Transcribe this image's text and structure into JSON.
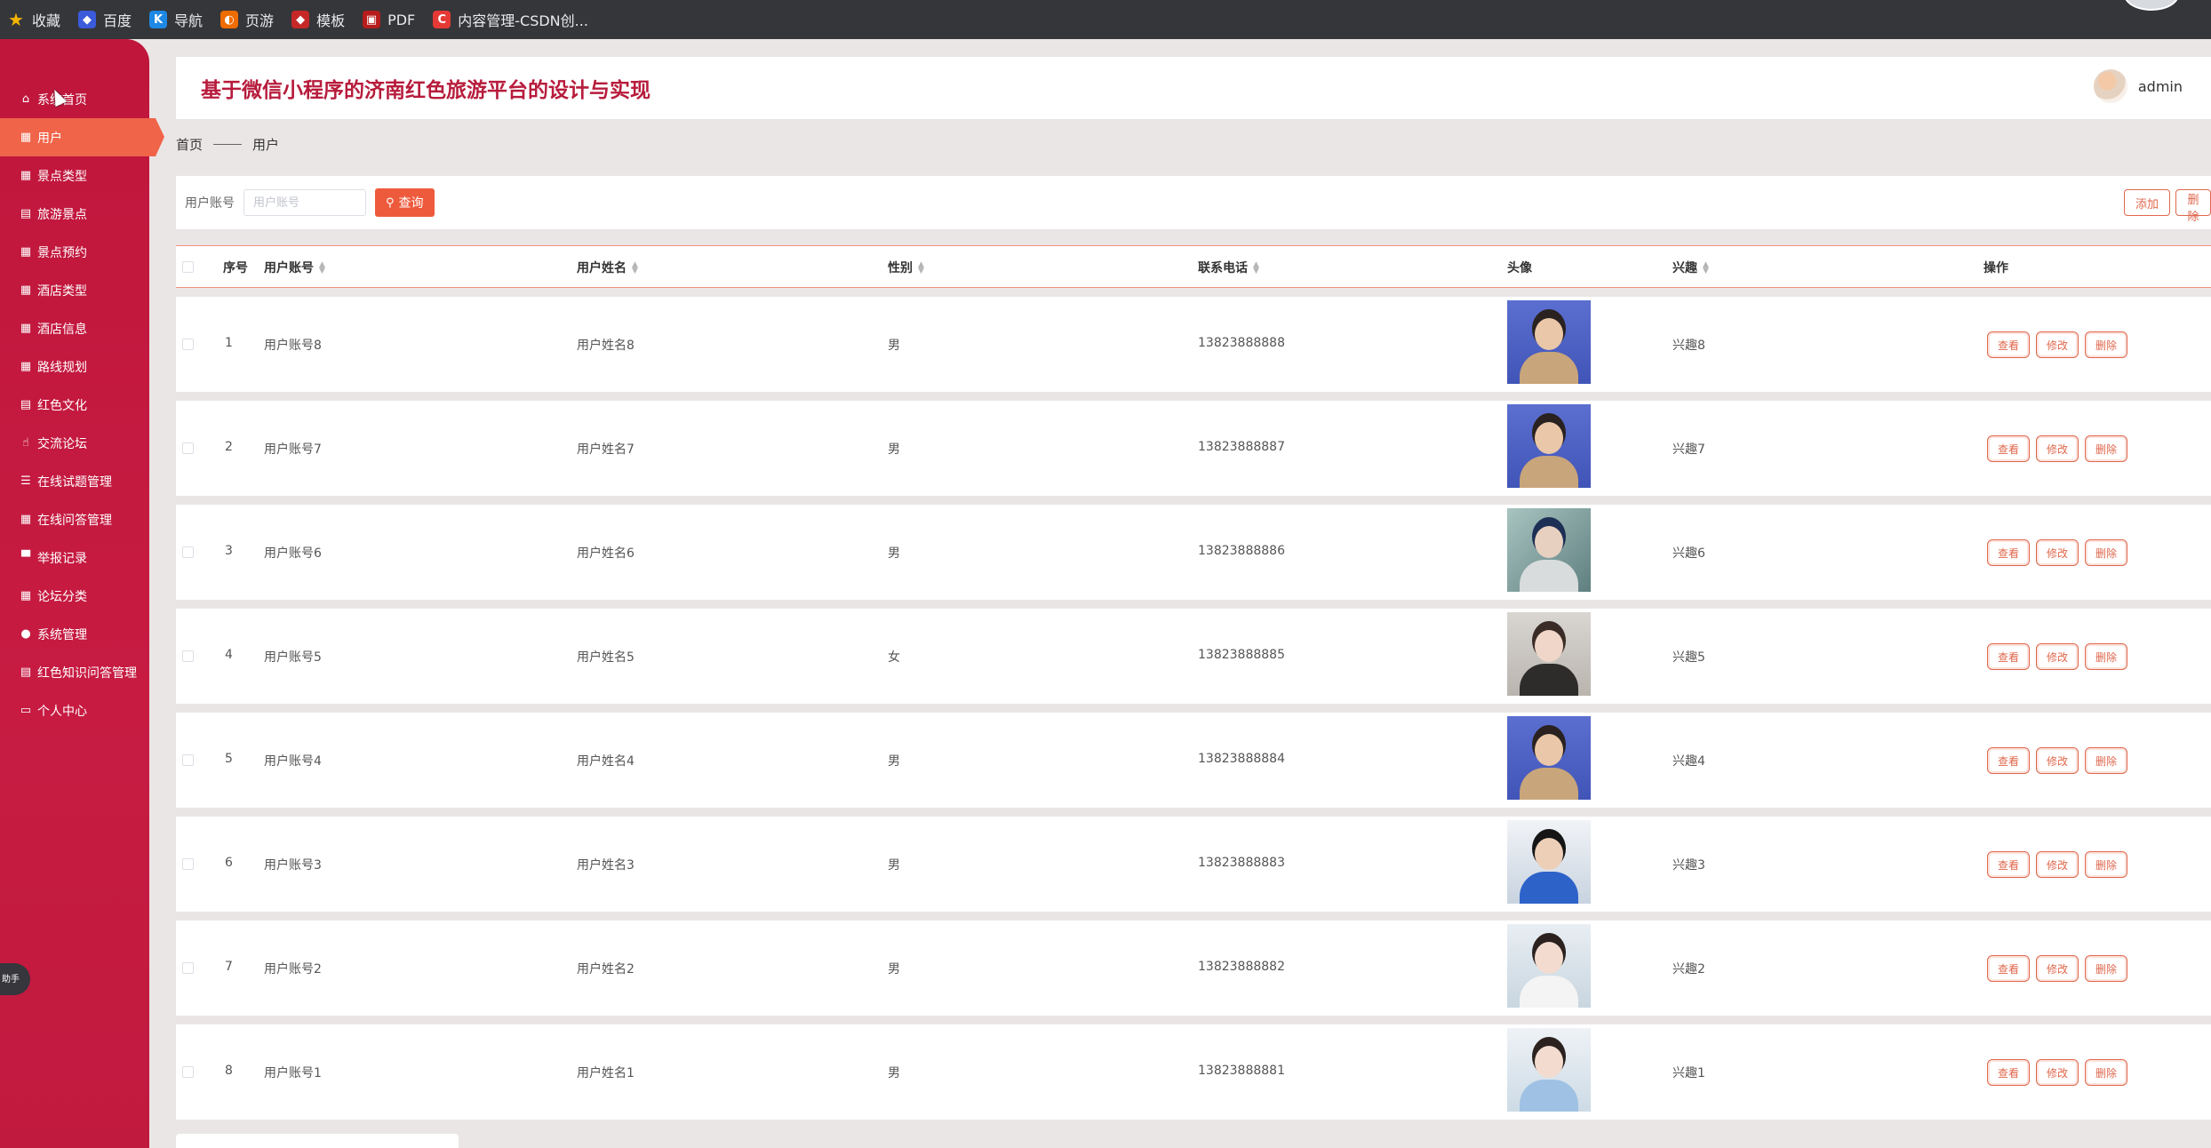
{
  "bookmarks": [
    {
      "label": "收藏",
      "icon": "star-icon"
    },
    {
      "label": "百度",
      "icon": "baidu-icon"
    },
    {
      "label": "导航",
      "icon": "nav-icon"
    },
    {
      "label": "页游",
      "icon": "game-icon"
    },
    {
      "label": "模板",
      "icon": "template-icon"
    },
    {
      "label": "PDF",
      "icon": "pdf-icon"
    },
    {
      "label": "内容管理-CSDN创...",
      "icon": "csdn-icon"
    }
  ],
  "sidebar": {
    "items": [
      {
        "label": "系统首页",
        "icon": "home-icon",
        "glyph": "⌂"
      },
      {
        "label": "用户",
        "icon": "grid-icon",
        "glyph": "▦",
        "active": true
      },
      {
        "label": "景点类型",
        "icon": "grid-icon",
        "glyph": "▦"
      },
      {
        "label": "旅游景点",
        "icon": "clipboard-icon",
        "glyph": "▤"
      },
      {
        "label": "景点预约",
        "icon": "grid-icon",
        "glyph": "▦"
      },
      {
        "label": "酒店类型",
        "icon": "grid-icon",
        "glyph": "▦"
      },
      {
        "label": "酒店信息",
        "icon": "grid-icon",
        "glyph": "▦"
      },
      {
        "label": "路线规划",
        "icon": "grid-icon",
        "glyph": "▦"
      },
      {
        "label": "红色文化",
        "icon": "clipboard-icon",
        "glyph": "▤"
      },
      {
        "label": "交流论坛",
        "icon": "thumb-icon",
        "glyph": "☝"
      },
      {
        "label": "在线试题管理",
        "icon": "list-icon",
        "glyph": "☰"
      },
      {
        "label": "在线问答管理",
        "icon": "grid-icon",
        "glyph": "▦"
      },
      {
        "label": "举报记录",
        "icon": "monitor-icon",
        "glyph": "▀"
      },
      {
        "label": "论坛分类",
        "icon": "grid-icon",
        "glyph": "▦"
      },
      {
        "label": "系统管理",
        "icon": "pin-icon",
        "glyph": "●"
      },
      {
        "label": "红色知识问答管理",
        "icon": "clipboard-icon",
        "glyph": "▤"
      },
      {
        "label": "个人中心",
        "icon": "card-icon",
        "glyph": "▭"
      }
    ],
    "assistant_label": "助手"
  },
  "header": {
    "title": "基于微信小程序的济南红色旅游平台的设计与实现",
    "username": "admin"
  },
  "breadcrumb": {
    "home": "首页",
    "current": "用户"
  },
  "search": {
    "label": "用户账号",
    "placeholder": "用户账号",
    "button": "查询",
    "add_button": "添加",
    "delete_button": "删除"
  },
  "table": {
    "headers": {
      "index": "序号",
      "account": "用户账号",
      "name": "用户姓名",
      "gender": "性别",
      "phone": "联系电话",
      "avatar": "头像",
      "interest": "兴趣",
      "actions": "操作"
    },
    "action_labels": {
      "view": "查看",
      "edit": "修改",
      "delete": "删除"
    },
    "rows": [
      {
        "index": "1",
        "account": "用户账号8",
        "name": "用户姓名8",
        "gender": "男",
        "phone": "13823888888",
        "interest": "兴趣8",
        "avatar": "man-trench-coat"
      },
      {
        "index": "2",
        "account": "用户账号7",
        "name": "用户姓名7",
        "gender": "男",
        "phone": "13823888887",
        "interest": "兴趣7",
        "avatar": "man-trench-coat"
      },
      {
        "index": "3",
        "account": "用户账号6",
        "name": "用户姓名6",
        "gender": "男",
        "phone": "13823888886",
        "interest": "兴趣6",
        "avatar": "man-cap"
      },
      {
        "index": "4",
        "account": "用户账号5",
        "name": "用户姓名5",
        "gender": "女",
        "phone": "13823888885",
        "interest": "兴趣5",
        "avatar": "woman-dark-top"
      },
      {
        "index": "5",
        "account": "用户账号4",
        "name": "用户姓名4",
        "gender": "男",
        "phone": "13823888884",
        "interest": "兴趣4",
        "avatar": "man-trench-coat"
      },
      {
        "index": "6",
        "account": "用户账号3",
        "name": "用户姓名3",
        "gender": "男",
        "phone": "13823888883",
        "interest": "兴趣3",
        "avatar": "man-blue-shirt"
      },
      {
        "index": "7",
        "account": "用户账号2",
        "name": "用户姓名2",
        "gender": "男",
        "phone": "13823888882",
        "interest": "兴趣2",
        "avatar": "woman-light"
      },
      {
        "index": "8",
        "account": "用户账号1",
        "name": "用户姓名1",
        "gender": "男",
        "phone": "13823888881",
        "interest": "兴趣1",
        "avatar": "woman-light-blue"
      }
    ]
  },
  "colors": {
    "sidebar": "#c0163c",
    "active": "#f0644a",
    "title": "#b71c3c",
    "accent": "#e0674d"
  }
}
